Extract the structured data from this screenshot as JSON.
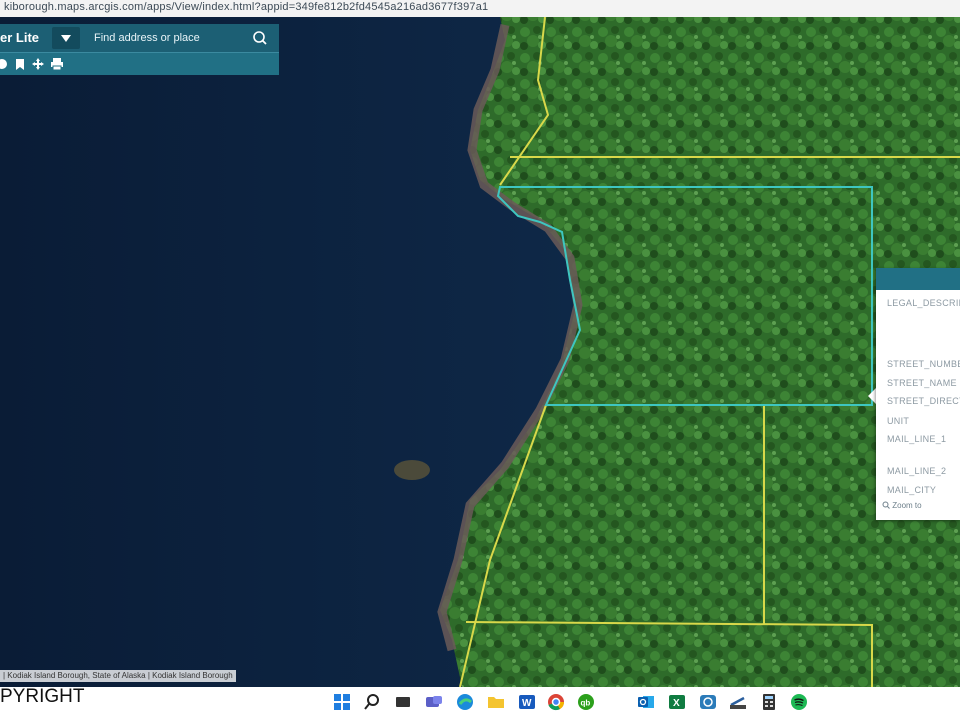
{
  "browser": {
    "url": "kiborough.maps.arcgis.com/apps/View/index.html?appid=349fe812b2fd4545a216ad3677f397a1"
  },
  "app": {
    "title": "er Lite",
    "search": {
      "placeholder": "Find address or place",
      "value": ""
    },
    "toolbar_icons": [
      "layers-icon",
      "bookmark-icon",
      "move-icon",
      "print-icon"
    ]
  },
  "map": {
    "basemap": "satellite imagery",
    "colors": {
      "water": "#0d2240",
      "forest": "#2f6e2c",
      "parcel_line": "#d8d84a",
      "selected_parcel": "#3ec6c0"
    }
  },
  "popup": {
    "fields": [
      "LEGAL_DESCRIP",
      "STREET_NUMBER",
      "STREET_NAME",
      "STREET_DIRECT",
      "UNIT",
      "MAIL_LINE_1",
      "MAIL_LINE_2",
      "MAIL_CITY"
    ],
    "zoom_label": "Zoom to"
  },
  "attribution": "| Kodiak Island Borough, State of Alaska | Kodiak Island Borough",
  "footer_text": "PYRIGHT",
  "taskbar": {
    "icons": [
      "windows-start-icon",
      "search-icon",
      "task-view-icon",
      "chat-icon",
      "edge-icon",
      "file-explorer-icon",
      "word-icon",
      "chrome-icon",
      "quickbooks-icon",
      "outlook-icon",
      "excel-icon",
      "app-icon",
      "scanner-icon",
      "calculator-icon",
      "spotify-icon"
    ]
  }
}
